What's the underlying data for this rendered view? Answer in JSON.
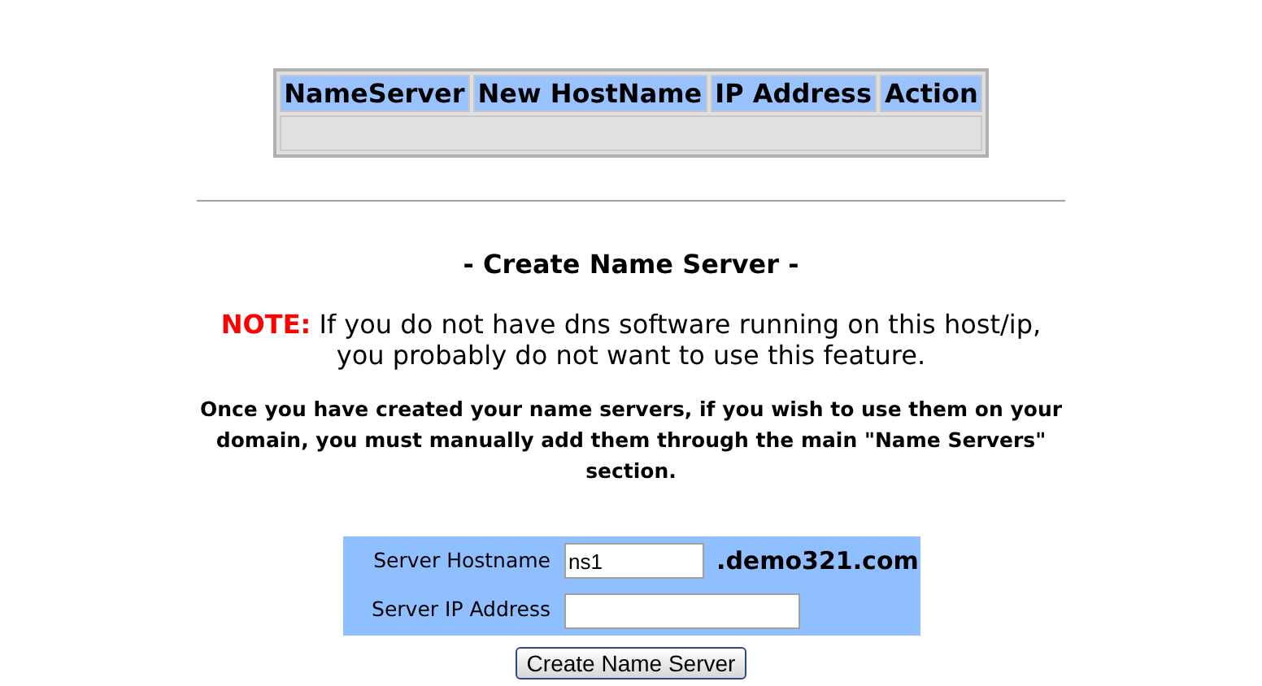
{
  "table": {
    "columns": [
      "NameServer",
      "New HostName",
      "IP Address",
      "Action"
    ]
  },
  "heading": "- Create Name Server -",
  "note": {
    "label": "NOTE:",
    "text": "If you do not have dns software running on this host/ip, you probably do not want to use this feature."
  },
  "info": "Once you have created your name servers, if you wish to use them on your domain, you must manually add them through the main \"Name Servers\" section.",
  "form": {
    "fields": [
      {
        "label": "Server Hostname",
        "value": "ns1",
        "suffix": ".demo321.com"
      },
      {
        "label": "Server IP Address"
      }
    ],
    "submit": "Create Name Server"
  }
}
